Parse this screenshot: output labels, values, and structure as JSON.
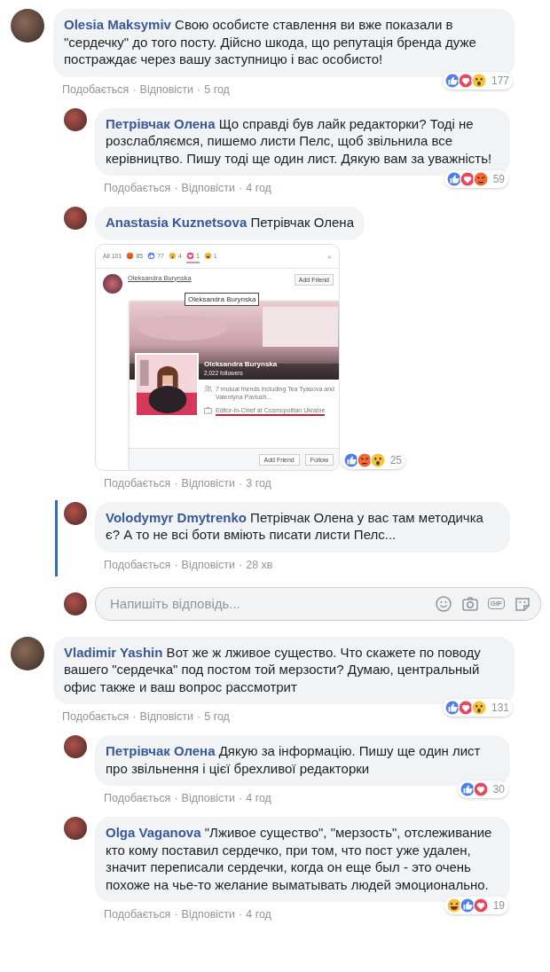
{
  "separator": "·",
  "threads": [
    {
      "author": "Olesia Maksymiv",
      "text": "Свою особисте ставлення ви вже показали в \"сердечку\" до того посту. Дійсно шкода, що репутація бренда дуже постраждає через вашу заступницю і вас особисто!",
      "like": "Подобається",
      "reply": "Відповісти",
      "time": "5 год",
      "reactions": {
        "icons": [
          {
            "kind": "like"
          },
          {
            "kind": "love"
          },
          {
            "kind": "wow"
          }
        ],
        "count": "177"
      },
      "replies": [
        {
          "author": "Петрівчак Олена",
          "text": "Що справді був лайк редакторки? Тоді не розслабляємся, пишемо листи Пелс, щоб звільнила все керівництво. Пишу тоді ще один лист. Дякую вам за уважність!",
          "like": "Подобається",
          "reply": "Відповісти",
          "time": "4 год",
          "highlighted": false,
          "reactions": {
            "icons": [
              {
                "kind": "like"
              },
              {
                "kind": "love"
              },
              {
                "kind": "angry"
              }
            ],
            "count": "59"
          }
        },
        {
          "author": "Anastasia Kuznetsova",
          "text": "Петрівчак Олена",
          "like": "Подобається",
          "reply": "Відповісти",
          "time": "3 год",
          "highlighted": false,
          "reactions": {
            "icons": [
              {
                "kind": "like"
              },
              {
                "kind": "angry"
              },
              {
                "kind": "wow"
              }
            ],
            "count": "25"
          },
          "attachment": {
            "kind": "screenshot",
            "tabs": [
              {
                "label": "All 101",
                "kind": "all",
                "selected": false
              },
              {
                "label": "85",
                "kind": "angry",
                "selected": false
              },
              {
                "label": "77",
                "kind": "like",
                "selected": false
              },
              {
                "label": "4",
                "kind": "wow",
                "selected": false
              },
              {
                "label": "1",
                "kind": "love",
                "selected": true
              },
              {
                "label": "1",
                "kind": "haha",
                "selected": false
              }
            ],
            "close": "×",
            "person": "Oleksandra Burynska",
            "add_friend": "Add Friend",
            "tooltip": "Oleksandra Burynska",
            "card": {
              "name": "Oleksandra Burynska",
              "followers": "2,022 followers",
              "mutual": "7 mutual friends including Tea Tyasova and Valentyna Pavlush...",
              "work": "Editor-in-Chief at Cosmopolitan Ukraine",
              "add_friend": "Add Friend",
              "follow": "Follow"
            }
          }
        },
        {
          "author": "Volodymyr Dmytrenko",
          "text": "Петрівчак Олена у вас там методичка є? А то не всі боти вміють писати листи Пелс...",
          "like": "Подобається",
          "reply": "Відповісти",
          "time": "28 хв",
          "highlighted": true
        }
      ],
      "reply_box": {
        "placeholder": "Напишіть відповідь...",
        "gif": "GIF"
      }
    },
    {
      "author": "Vladimir Yashin",
      "text": "Вот же ж лживое существо. Что скажете по поводу вашего \"сердечка\" под постом той мерзости? Думаю, центральный офис также и ваш вопрос рассмотрит",
      "like": "Подобається",
      "reply": "Відповісти",
      "time": "5 год",
      "reactions": {
        "icons": [
          {
            "kind": "like"
          },
          {
            "kind": "love"
          },
          {
            "kind": "wow"
          }
        ],
        "count": "131"
      },
      "replies": [
        {
          "author": "Петрівчак Олена",
          "text": "Дякую за інформацію. Пишу ще один лист про звільнення і цієї брехливої редакторки",
          "like": "Подобається",
          "reply": "Відповісти",
          "time": "4 год",
          "highlighted": false,
          "reactions": {
            "icons": [
              {
                "kind": "like"
              },
              {
                "kind": "love"
              }
            ],
            "count": "30"
          }
        },
        {
          "author": "Olga Vaganova",
          "text": "\"Лживое существо\", \"мерзость\", отслеживание кто кому поставил сердечко, при том, что пост уже удален, значит переписали сердечки, когда он еще был - это очень похоже на чье-то желание выматывать людей эмоционально.",
          "like": "Подобається",
          "reply": "Відповісти",
          "time": "4 год",
          "highlighted": false,
          "reactions": {
            "icons": [
              {
                "kind": "haha"
              },
              {
                "kind": "like"
              },
              {
                "kind": "love"
              }
            ],
            "count": "19"
          }
        }
      ]
    }
  ]
}
